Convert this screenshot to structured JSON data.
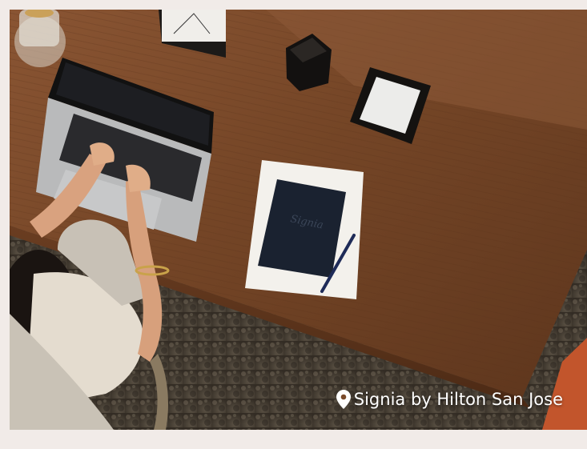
{
  "photo": {
    "scene": "overhead-view-woman-working-at-laptop-on-wooden-desk",
    "caption_icon": "location-pin-icon",
    "caption": "Signia by Hilton San Jose"
  },
  "colors": {
    "background": "#f1ebe8",
    "desk_wood": "#7a4a2a",
    "caption_text": "#ffffff"
  }
}
